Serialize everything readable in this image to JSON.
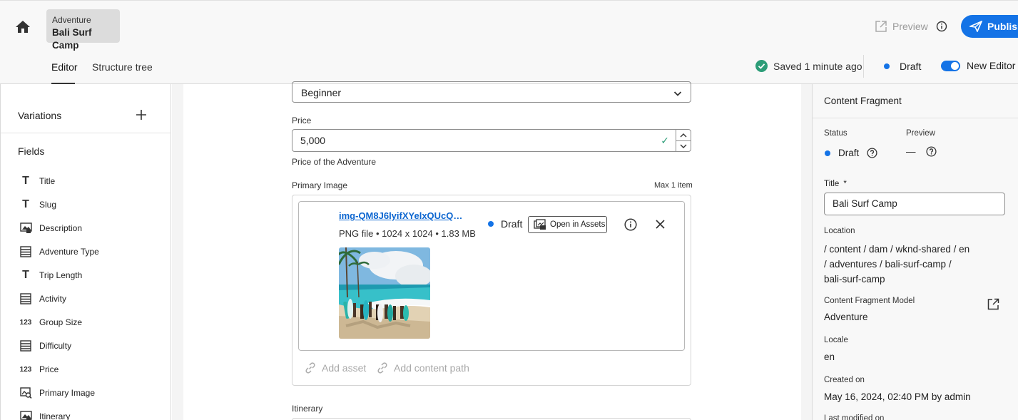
{
  "header": {
    "breadcrumb": {
      "type": "Adventure",
      "name": "Bali Surf Camp"
    },
    "preview_label": "Preview",
    "publish_label": "Publish",
    "tabs": [
      {
        "label": "Editor",
        "active": true
      },
      {
        "label": "Structure tree",
        "active": false
      }
    ],
    "saved_status": "Saved 1 minute ago",
    "draft_label": "Draft",
    "new_editor_label": "New Editor",
    "new_editor_on": true
  },
  "left_panel": {
    "variations_label": "Variations",
    "fields_label": "Fields",
    "fields": [
      {
        "label": "Title",
        "icon": "text-icon"
      },
      {
        "label": "Slug",
        "icon": "text-icon"
      },
      {
        "label": "Description",
        "icon": "rich-text-icon"
      },
      {
        "label": "Adventure Type",
        "icon": "enumeration-icon"
      },
      {
        "label": "Trip Length",
        "icon": "text-icon"
      },
      {
        "label": "Activity",
        "icon": "enumeration-icon"
      },
      {
        "label": "Group Size",
        "icon": "number-icon"
      },
      {
        "label": "Difficulty",
        "icon": "enumeration-icon"
      },
      {
        "label": "Price",
        "icon": "number-icon"
      },
      {
        "label": "Primary Image",
        "icon": "content-reference-icon"
      },
      {
        "label": "Itinerary",
        "icon": "rich-text-icon"
      }
    ]
  },
  "editor": {
    "difficulty_value": "Beginner",
    "price_label": "Price",
    "price_value": "5,000",
    "price_help": "Price of the Adventure",
    "primary_image_label": "Primary Image",
    "max_items": "Max 1 item",
    "asset": {
      "filename": "img-QM8J6lyifXYelxQUcQ8c...",
      "meta": "PNG file • 1024 x 1024 • 1.83 MB",
      "status": "Draft",
      "open_in_assets": "Open in Assets"
    },
    "add_asset_label": "Add asset",
    "add_content_path_label": "Add content path",
    "itinerary_label": "Itinerary"
  },
  "right_panel": {
    "title": "Content Fragment",
    "status_label": "Status",
    "status_value": "Draft",
    "preview_label": "Preview",
    "preview_value": "—",
    "title_label": "Title",
    "title_required": "*",
    "title_value": "Bali Surf Camp",
    "location_label": "Location",
    "location_value": " / content / dam / wknd-shared / en / adventures / bali-surf-camp / bali-surf-camp",
    "model_label": "Content Fragment Model",
    "model_value": "Adventure",
    "locale_label": "Locale",
    "locale_value": "en",
    "created_label": "Created on",
    "created_value": "May 16, 2024, 02:40 PM by admin",
    "last_modified_label": "Last modified on"
  },
  "colors": {
    "accent": "#1473e6",
    "success": "#2d9d78",
    "link": "#0d66d0"
  }
}
